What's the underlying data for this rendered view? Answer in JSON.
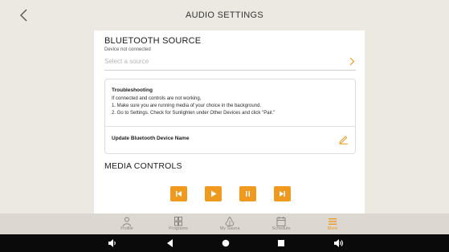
{
  "header": {
    "title": "AUDIO SETTINGS"
  },
  "bluetooth": {
    "title": "BLUETOOTH SOURCE",
    "status": "Device not connected",
    "source_placeholder": "Select a source"
  },
  "troubleshooting": {
    "title": "Troubleshooting",
    "lines": [
      "If connected and controls are not working,",
      "1. Make sure you are running media of your choice in the background.",
      "2. Go to Settings. Check for Sunlighten under Other Devices and click \"Pair.\""
    ],
    "update_label": "Update Bluetooth Device Name"
  },
  "media": {
    "title": "MEDIA CONTROLS"
  },
  "nav": {
    "items": [
      {
        "label": "Profile",
        "icon": "profile-icon"
      },
      {
        "label": "Programs",
        "icon": "grid-icon"
      },
      {
        "label": "My Sauna",
        "icon": "sauna-icon"
      },
      {
        "label": "Schedule",
        "icon": "calendar-icon"
      },
      {
        "label": "More",
        "icon": "menu-icon"
      }
    ],
    "active": "More"
  },
  "colors": {
    "accent": "#ef9a1e",
    "background": "#ece9e3",
    "nav_background": "#dcd8d1",
    "system_bar": "#0a0a0a"
  }
}
